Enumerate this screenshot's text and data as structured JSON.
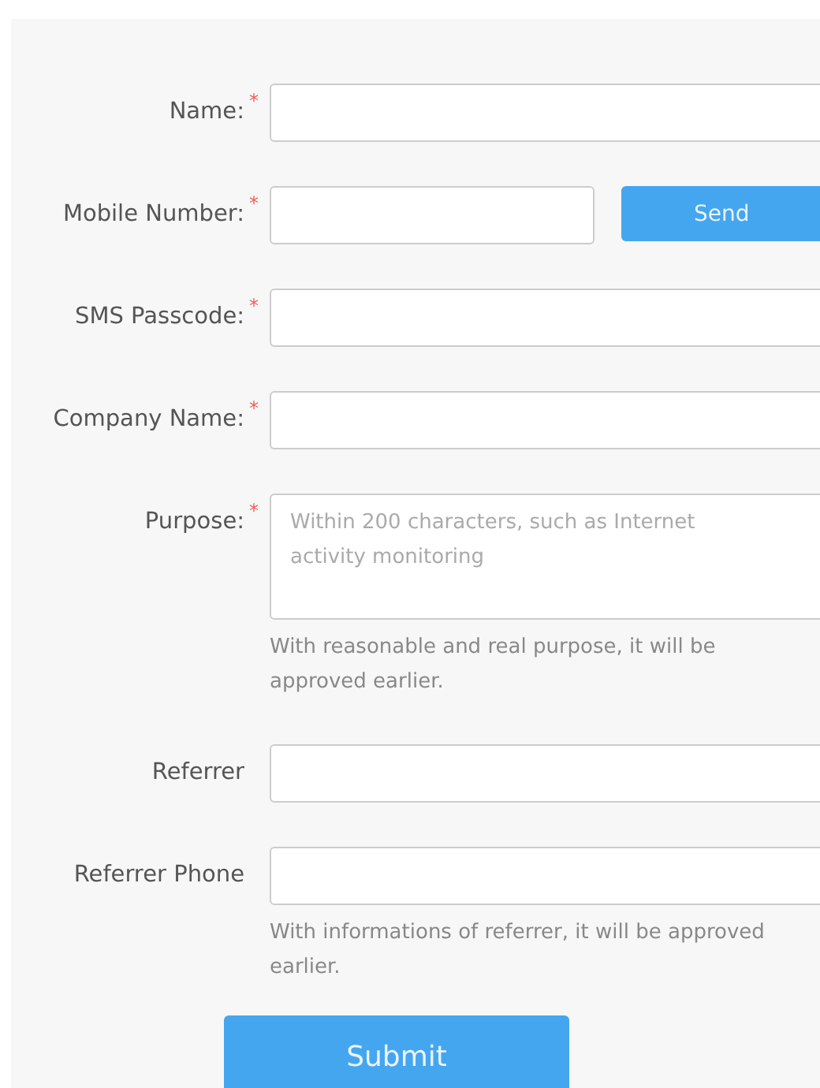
{
  "fields": [
    {
      "kind": "text",
      "label": "Name:",
      "required_mark": "*"
    },
    {
      "kind": "text_with_button",
      "label": "Mobile Number:",
      "required_mark": "*",
      "button": "Send"
    },
    {
      "kind": "text",
      "label": "SMS Passcode:",
      "required_mark": "*"
    },
    {
      "kind": "text",
      "label": "Company Name:",
      "required_mark": "*"
    },
    {
      "kind": "textarea",
      "label": "Purpose:",
      "required_mark": "*",
      "placeholder": "Within 200 characters, such as Internet activity monitoring",
      "hint": "With reasonable and real purpose, it will be approved earlier."
    },
    {
      "kind": "text",
      "label": "Referrer"
    },
    {
      "kind": "text",
      "label": "Referrer Phone",
      "hint": "With informations of referrer, it will be approved earlier."
    }
  ],
  "submit": "Submit"
}
